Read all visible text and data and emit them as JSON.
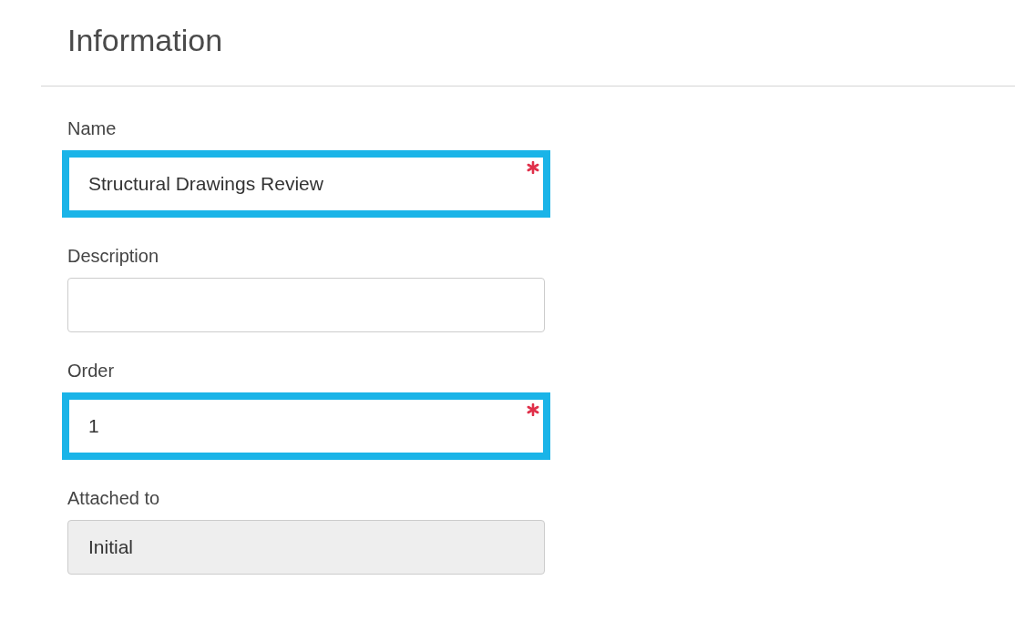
{
  "section": {
    "title": "Information"
  },
  "fields": [
    {
      "label": "Name",
      "value": "Structural Drawings Review",
      "required": true,
      "highlighted": true,
      "disabled": false
    },
    {
      "label": "Description",
      "required": false,
      "highlighted": false,
      "disabled": false
    },
    {
      "label": "Order",
      "value": "1",
      "required": true,
      "highlighted": true,
      "disabled": false
    },
    {
      "label": "Attached to",
      "value": "Initial",
      "required": false,
      "highlighted": false,
      "disabled": true
    }
  ]
}
